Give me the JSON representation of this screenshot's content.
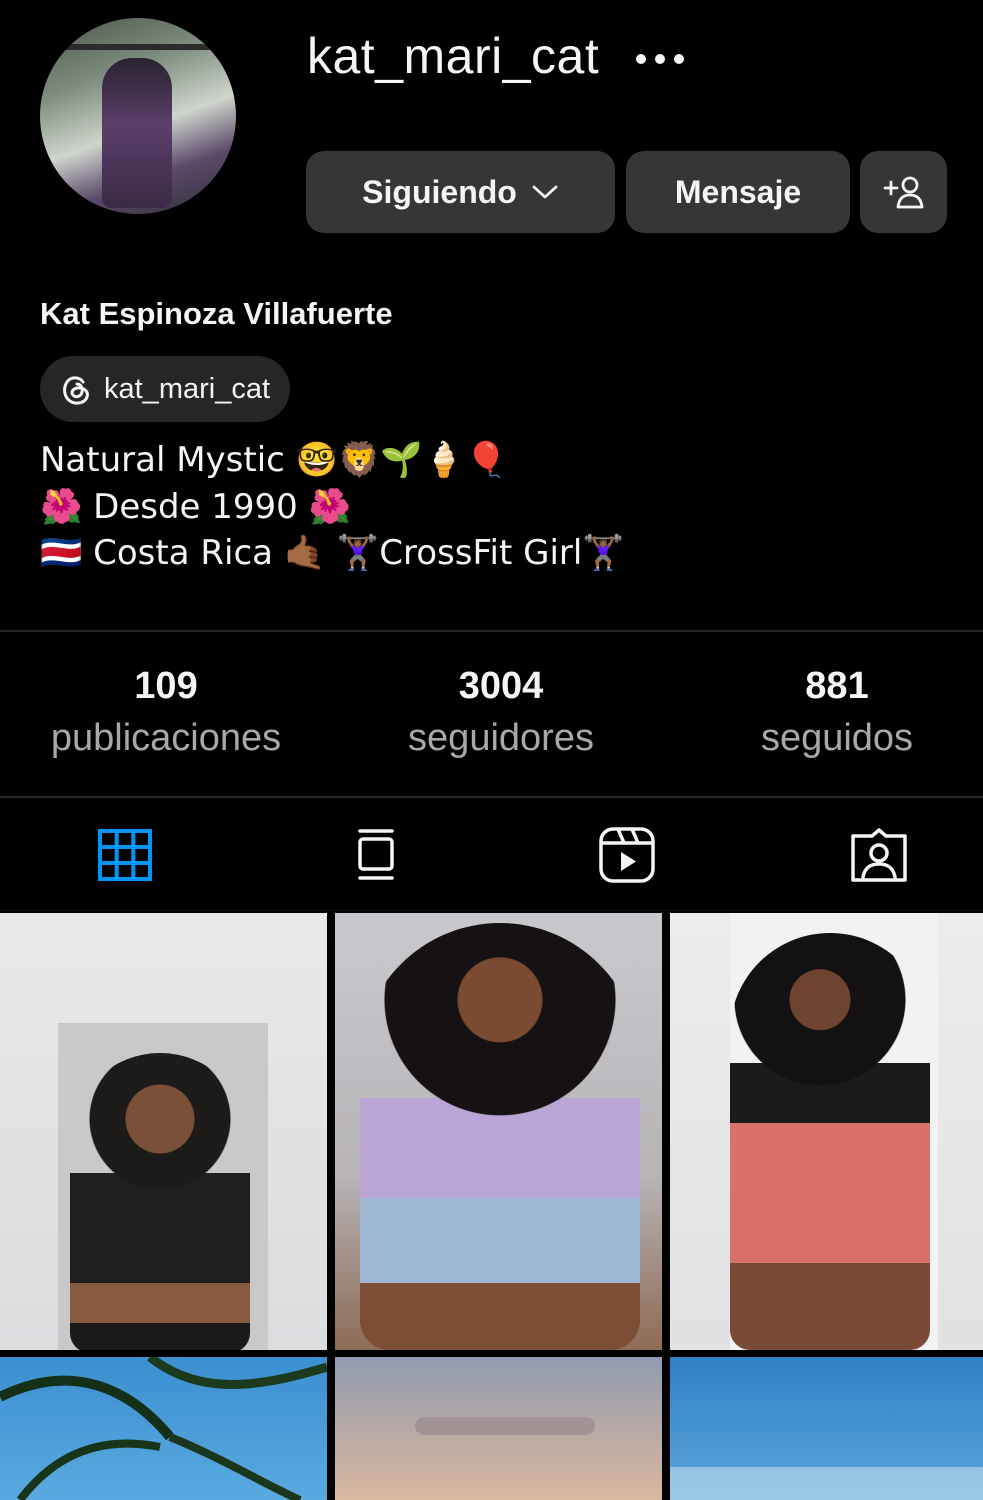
{
  "profile": {
    "username": "kat_mari_cat",
    "full_name": "Kat Espinoza Villafuerte",
    "threads_handle": "kat_mari_cat",
    "bio_lines": [
      "Natural Mystic 🤓🦁🌱🍦🎈",
      "🌺 Desde 1990 🌺",
      "🇨🇷 Costa Rica 🤙🏾 🏋🏾‍♀️CrossFit Girl🏋🏾‍♀️"
    ]
  },
  "actions": {
    "following_label": "Siguiendo",
    "message_label": "Mensaje"
  },
  "stats": {
    "posts_count": "109",
    "posts_label": "publicaciones",
    "followers_count": "3004",
    "followers_label": "seguidores",
    "following_count": "881",
    "following_label": "seguidos"
  },
  "tabs": [
    {
      "icon": "grid-icon",
      "active": true
    },
    {
      "icon": "feed-icon",
      "active": false
    },
    {
      "icon": "reels-icon",
      "active": false
    },
    {
      "icon": "tagged-icon",
      "active": false
    }
  ],
  "colors": {
    "background": "#000000",
    "button": "#363636",
    "active_tab": "#0095f6",
    "secondary_text": "#a8a8a8"
  },
  "icons": [
    "more-options-icon",
    "chevron-down-icon",
    "add-user-icon",
    "threads-icon"
  ]
}
